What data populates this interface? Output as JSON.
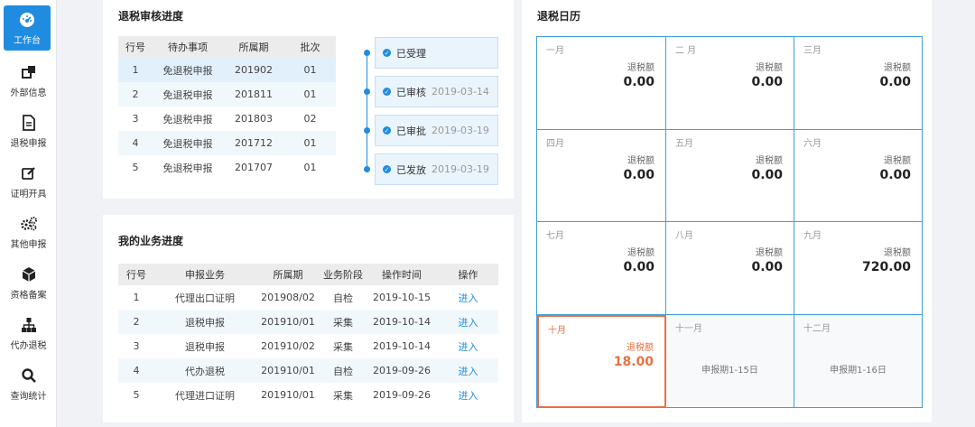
{
  "sidebar": {
    "items": [
      {
        "label": "工作台",
        "icon": "dashboard-icon",
        "active": true
      },
      {
        "label": "外部信息",
        "icon": "windows-icon"
      },
      {
        "label": "退税申报",
        "icon": "document-icon"
      },
      {
        "label": "证明开具",
        "icon": "edit-icon"
      },
      {
        "label": "其他申报",
        "icon": "gears-icon"
      },
      {
        "label": "资格备案",
        "icon": "cube-icon"
      },
      {
        "label": "代办退税",
        "icon": "org-chart-icon"
      },
      {
        "label": "查询统计",
        "icon": "search-icon"
      }
    ]
  },
  "review": {
    "title": "退税审核进度",
    "headers": [
      "行号",
      "待办事项",
      "所属期",
      "批次"
    ],
    "rows": [
      [
        "1",
        "免退税申报",
        "201902",
        "01"
      ],
      [
        "2",
        "免退税申报",
        "201811",
        "01"
      ],
      [
        "3",
        "免退税申报",
        "201803",
        "02"
      ],
      [
        "4",
        "免退税申报",
        "201712",
        "01"
      ],
      [
        "5",
        "免退税申报",
        "201707",
        "01"
      ]
    ],
    "steps": [
      {
        "label": "已受理",
        "date": ""
      },
      {
        "label": "已审核",
        "date": "2019-03-14"
      },
      {
        "label": "已审批",
        "date": "2019-03-19"
      },
      {
        "label": "已发放",
        "date": "2019-03-19"
      }
    ]
  },
  "business": {
    "title": "我的业务进度",
    "headers": [
      "行号",
      "申报业务",
      "所属期",
      "业务阶段",
      "操作时间",
      "操作"
    ],
    "rows": [
      [
        "1",
        "代理出口证明",
        "201908/02",
        "自检",
        "2019-10-15",
        "进入"
      ],
      [
        "2",
        "退税申报",
        "201910/01",
        "采集",
        "2019-10-14",
        "进入"
      ],
      [
        "3",
        "退税申报",
        "201910/02",
        "采集",
        "2019-10-14",
        "进入"
      ],
      [
        "4",
        "代办退税",
        "201910/01",
        "自检",
        "2019-09-26",
        "进入"
      ],
      [
        "5",
        "代理进口证明",
        "201910/01",
        "采集",
        "2019-09-26",
        "进入"
      ]
    ]
  },
  "calendar": {
    "title": "退税日历",
    "amount_label": "退税额",
    "months": [
      {
        "month": "一月",
        "amount": "0.00"
      },
      {
        "month": "二 月",
        "amount": "0.00"
      },
      {
        "month": "三月",
        "amount": "0.00"
      },
      {
        "month": "四月",
        "amount": "0.00"
      },
      {
        "month": "五月",
        "amount": "0.00"
      },
      {
        "month": "六月",
        "amount": "0.00"
      },
      {
        "month": "七月",
        "amount": "0.00"
      },
      {
        "month": "八月",
        "amount": "0.00"
      },
      {
        "month": "九月",
        "amount": "720.00"
      },
      {
        "month": "十月",
        "amount": "18.00",
        "current": true
      },
      {
        "month": "十一月",
        "period": "申报期1-15日"
      },
      {
        "month": "十二月",
        "period": "申报期1-16日"
      }
    ]
  },
  "colors": {
    "accent": "#1f8ce0",
    "current_month": "#e87040",
    "calendar_border": "#3da0d9"
  }
}
